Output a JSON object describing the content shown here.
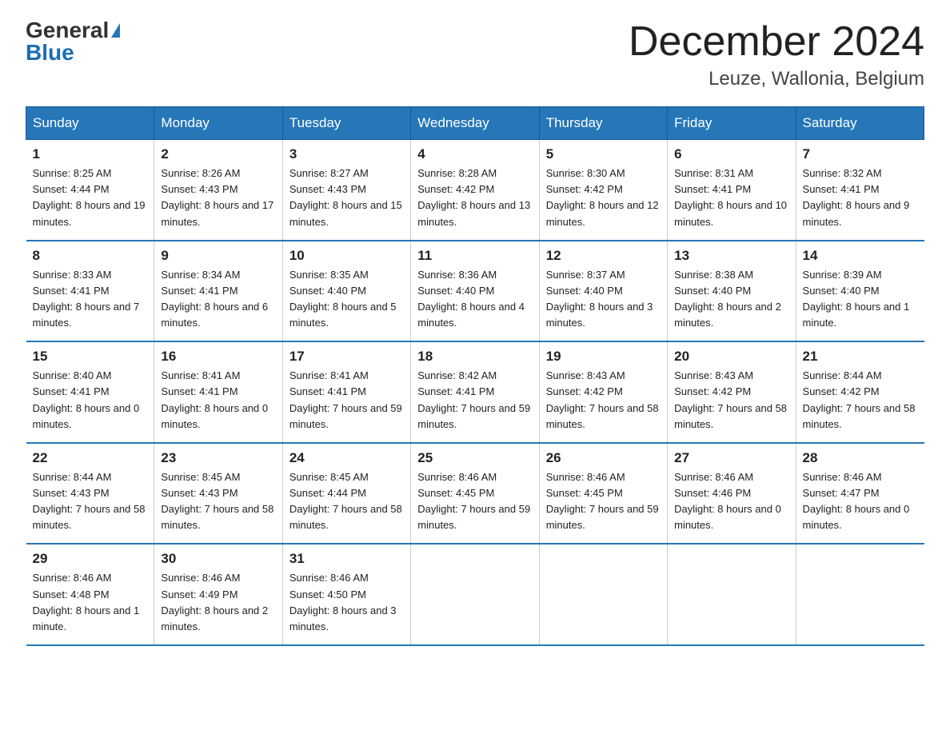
{
  "logo": {
    "general": "General",
    "blue": "Blue",
    "triangle": "▶"
  },
  "title": "December 2024",
  "location": "Leuze, Wallonia, Belgium",
  "days_of_week": [
    "Sunday",
    "Monday",
    "Tuesday",
    "Wednesday",
    "Thursday",
    "Friday",
    "Saturday"
  ],
  "weeks": [
    [
      {
        "num": "1",
        "sunrise": "8:25 AM",
        "sunset": "4:44 PM",
        "daylight": "8 hours and 19 minutes."
      },
      {
        "num": "2",
        "sunrise": "8:26 AM",
        "sunset": "4:43 PM",
        "daylight": "8 hours and 17 minutes."
      },
      {
        "num": "3",
        "sunrise": "8:27 AM",
        "sunset": "4:43 PM",
        "daylight": "8 hours and 15 minutes."
      },
      {
        "num": "4",
        "sunrise": "8:28 AM",
        "sunset": "4:42 PM",
        "daylight": "8 hours and 13 minutes."
      },
      {
        "num": "5",
        "sunrise": "8:30 AM",
        "sunset": "4:42 PM",
        "daylight": "8 hours and 12 minutes."
      },
      {
        "num": "6",
        "sunrise": "8:31 AM",
        "sunset": "4:41 PM",
        "daylight": "8 hours and 10 minutes."
      },
      {
        "num": "7",
        "sunrise": "8:32 AM",
        "sunset": "4:41 PM",
        "daylight": "8 hours and 9 minutes."
      }
    ],
    [
      {
        "num": "8",
        "sunrise": "8:33 AM",
        "sunset": "4:41 PM",
        "daylight": "8 hours and 7 minutes."
      },
      {
        "num": "9",
        "sunrise": "8:34 AM",
        "sunset": "4:41 PM",
        "daylight": "8 hours and 6 minutes."
      },
      {
        "num": "10",
        "sunrise": "8:35 AM",
        "sunset": "4:40 PM",
        "daylight": "8 hours and 5 minutes."
      },
      {
        "num": "11",
        "sunrise": "8:36 AM",
        "sunset": "4:40 PM",
        "daylight": "8 hours and 4 minutes."
      },
      {
        "num": "12",
        "sunrise": "8:37 AM",
        "sunset": "4:40 PM",
        "daylight": "8 hours and 3 minutes."
      },
      {
        "num": "13",
        "sunrise": "8:38 AM",
        "sunset": "4:40 PM",
        "daylight": "8 hours and 2 minutes."
      },
      {
        "num": "14",
        "sunrise": "8:39 AM",
        "sunset": "4:40 PM",
        "daylight": "8 hours and 1 minute."
      }
    ],
    [
      {
        "num": "15",
        "sunrise": "8:40 AM",
        "sunset": "4:41 PM",
        "daylight": "8 hours and 0 minutes."
      },
      {
        "num": "16",
        "sunrise": "8:41 AM",
        "sunset": "4:41 PM",
        "daylight": "8 hours and 0 minutes."
      },
      {
        "num": "17",
        "sunrise": "8:41 AM",
        "sunset": "4:41 PM",
        "daylight": "7 hours and 59 minutes."
      },
      {
        "num": "18",
        "sunrise": "8:42 AM",
        "sunset": "4:41 PM",
        "daylight": "7 hours and 59 minutes."
      },
      {
        "num": "19",
        "sunrise": "8:43 AM",
        "sunset": "4:42 PM",
        "daylight": "7 hours and 58 minutes."
      },
      {
        "num": "20",
        "sunrise": "8:43 AM",
        "sunset": "4:42 PM",
        "daylight": "7 hours and 58 minutes."
      },
      {
        "num": "21",
        "sunrise": "8:44 AM",
        "sunset": "4:42 PM",
        "daylight": "7 hours and 58 minutes."
      }
    ],
    [
      {
        "num": "22",
        "sunrise": "8:44 AM",
        "sunset": "4:43 PM",
        "daylight": "7 hours and 58 minutes."
      },
      {
        "num": "23",
        "sunrise": "8:45 AM",
        "sunset": "4:43 PM",
        "daylight": "7 hours and 58 minutes."
      },
      {
        "num": "24",
        "sunrise": "8:45 AM",
        "sunset": "4:44 PM",
        "daylight": "7 hours and 58 minutes."
      },
      {
        "num": "25",
        "sunrise": "8:46 AM",
        "sunset": "4:45 PM",
        "daylight": "7 hours and 59 minutes."
      },
      {
        "num": "26",
        "sunrise": "8:46 AM",
        "sunset": "4:45 PM",
        "daylight": "7 hours and 59 minutes."
      },
      {
        "num": "27",
        "sunrise": "8:46 AM",
        "sunset": "4:46 PM",
        "daylight": "8 hours and 0 minutes."
      },
      {
        "num": "28",
        "sunrise": "8:46 AM",
        "sunset": "4:47 PM",
        "daylight": "8 hours and 0 minutes."
      }
    ],
    [
      {
        "num": "29",
        "sunrise": "8:46 AM",
        "sunset": "4:48 PM",
        "daylight": "8 hours and 1 minute."
      },
      {
        "num": "30",
        "sunrise": "8:46 AM",
        "sunset": "4:49 PM",
        "daylight": "8 hours and 2 minutes."
      },
      {
        "num": "31",
        "sunrise": "8:46 AM",
        "sunset": "4:50 PM",
        "daylight": "8 hours and 3 minutes."
      },
      null,
      null,
      null,
      null
    ]
  ],
  "labels": {
    "sunrise": "Sunrise:",
    "sunset": "Sunset:",
    "daylight": "Daylight:"
  }
}
